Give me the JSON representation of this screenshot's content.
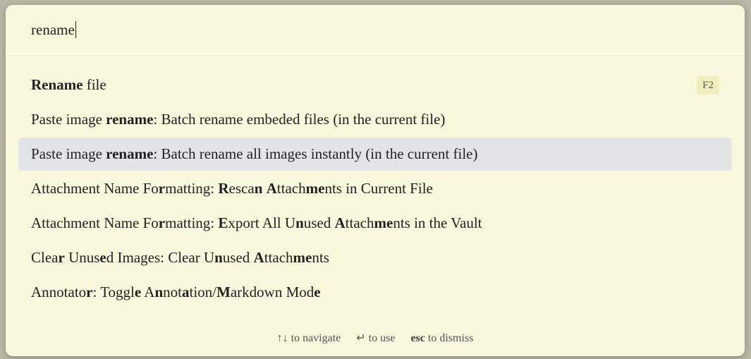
{
  "search": {
    "value": "rename"
  },
  "results": [
    {
      "segments": [
        [
          "Rename",
          true
        ],
        [
          " file",
          false
        ]
      ],
      "hotkey": "F2",
      "selected": false
    },
    {
      "segments": [
        [
          "Paste image ",
          false
        ],
        [
          "rename",
          true
        ],
        [
          ": Batch rename embeded files (in the current file)",
          false
        ]
      ],
      "selected": false
    },
    {
      "segments": [
        [
          "Paste image ",
          false
        ],
        [
          "rename",
          true
        ],
        [
          ": Batch rename all images instantly (in the current file)",
          false
        ]
      ],
      "selected": true
    },
    {
      "segments": [
        [
          "Attachment Name Fo",
          false
        ],
        [
          "r",
          true
        ],
        [
          "matting: ",
          false
        ],
        [
          "R",
          true
        ],
        [
          "esca",
          false
        ],
        [
          "n",
          true
        ],
        [
          " ",
          false
        ],
        [
          "A",
          true
        ],
        [
          "ttach",
          false
        ],
        [
          "me",
          true
        ],
        [
          "nts in Current File",
          false
        ]
      ],
      "selected": false
    },
    {
      "segments": [
        [
          "Attachment Name Fo",
          false
        ],
        [
          "r",
          true
        ],
        [
          "matting: ",
          false
        ],
        [
          "E",
          true
        ],
        [
          "xport All U",
          false
        ],
        [
          "n",
          true
        ],
        [
          "used ",
          false
        ],
        [
          "A",
          true
        ],
        [
          "ttach",
          false
        ],
        [
          "me",
          true
        ],
        [
          "nts in the Vault",
          false
        ]
      ],
      "selected": false
    },
    {
      "segments": [
        [
          "Clea",
          false
        ],
        [
          "r",
          true
        ],
        [
          " Unus",
          false
        ],
        [
          "e",
          true
        ],
        [
          "d Images: Clear U",
          false
        ],
        [
          "n",
          true
        ],
        [
          "used ",
          false
        ],
        [
          "A",
          true
        ],
        [
          "ttach",
          false
        ],
        [
          "me",
          true
        ],
        [
          "nts",
          false
        ]
      ],
      "selected": false
    },
    {
      "segments": [
        [
          "Annotato",
          false
        ],
        [
          "r",
          true
        ],
        [
          ": Toggl",
          false
        ],
        [
          "e",
          true
        ],
        [
          " A",
          false
        ],
        [
          "n",
          true
        ],
        [
          "not",
          false
        ],
        [
          "a",
          true
        ],
        [
          "tion/",
          false
        ],
        [
          "M",
          true
        ],
        [
          "arkdown Mod",
          false
        ],
        [
          "e",
          true
        ]
      ],
      "selected": false
    }
  ],
  "footer": {
    "navigate_keys": "↑↓",
    "navigate_label": "to navigate",
    "use_key": "↵",
    "use_label": "to use",
    "dismiss_key": "esc",
    "dismiss_label": "to dismiss"
  },
  "colors": {
    "background": "#f9f7dc",
    "selected": "#e2e4e6",
    "hotkey_bg": "#f3eebe"
  }
}
